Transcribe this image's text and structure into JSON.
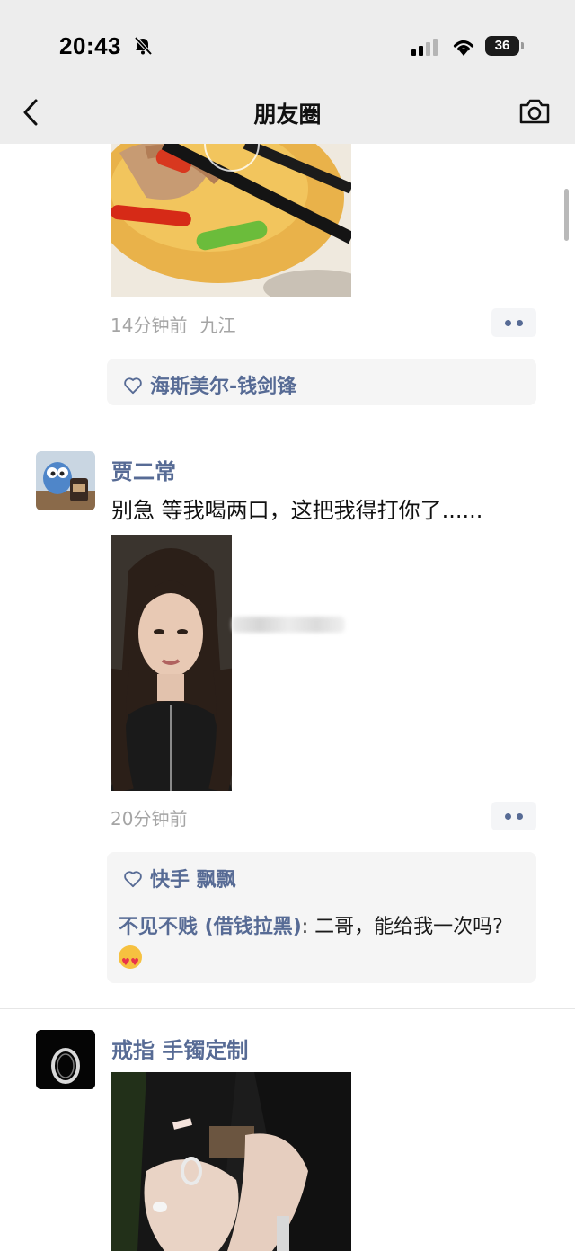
{
  "status_bar": {
    "time": "20:43",
    "battery": "36"
  },
  "nav": {
    "title": "朋友圈"
  },
  "posts": [
    {
      "time": "14分钟前",
      "location": "九江",
      "likes": "海斯美尔-钱剑锋"
    },
    {
      "user": "贾二常",
      "text": "别急 等我喝两口，这把我得打你了......",
      "time": "20分钟前",
      "likes": "快手 飘飘",
      "comment": {
        "name": "不见不贱 (借钱拉黑)",
        "text": ": 二哥，能给我一次吗?"
      }
    },
    {
      "user": "戒指 手镯定制"
    }
  ],
  "colors": {
    "link": "#576b95",
    "nav_bg": "#ededed",
    "meta_gray": "#a5a5a5",
    "box_bg": "#f5f5f5"
  }
}
